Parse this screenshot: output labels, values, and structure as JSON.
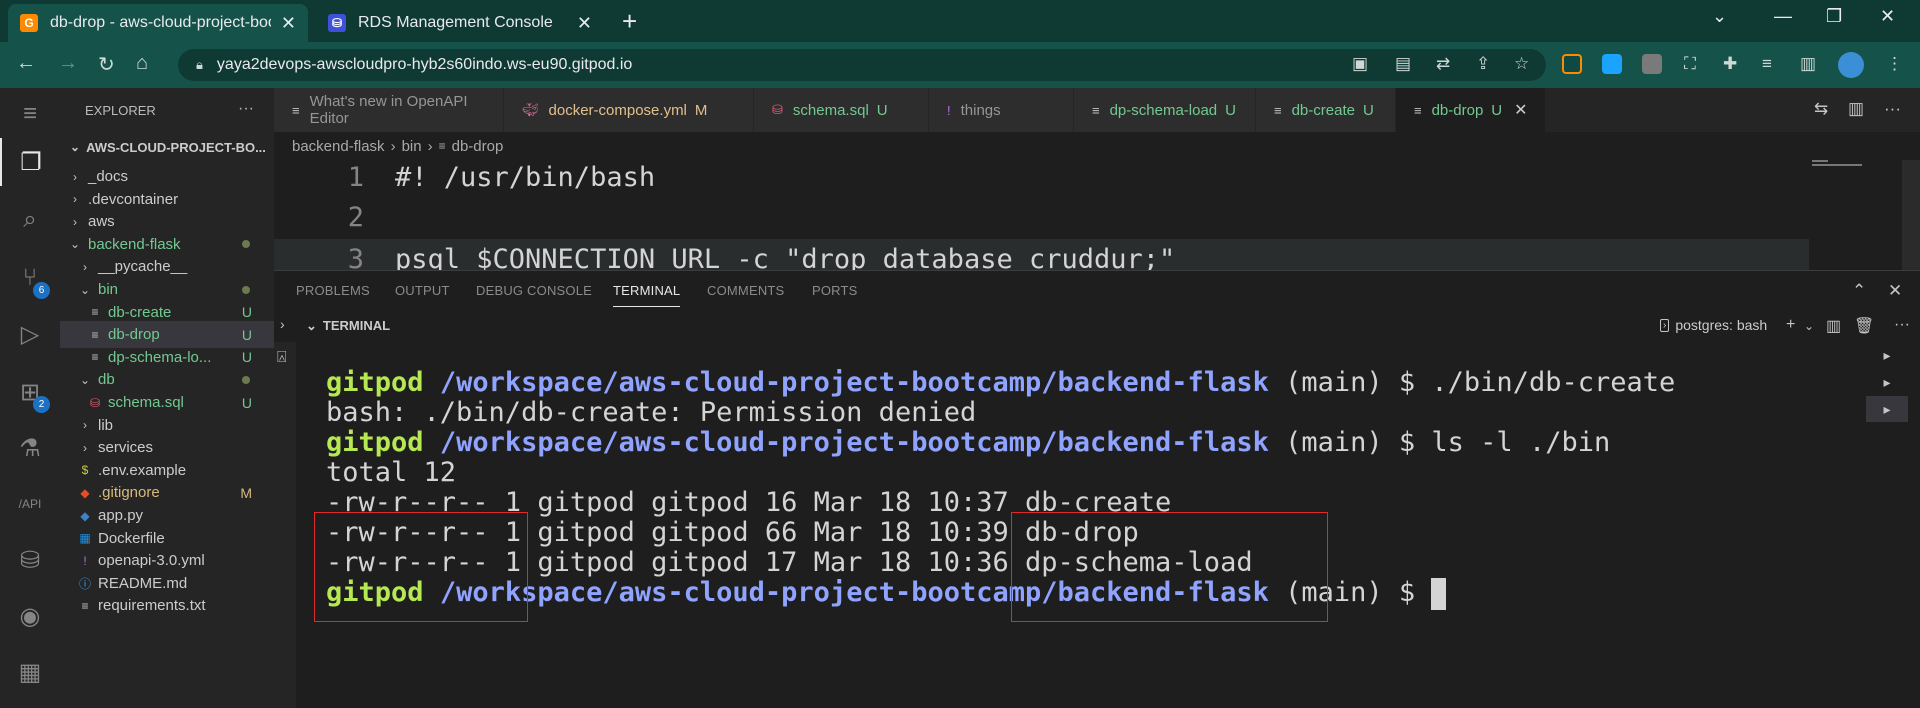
{
  "browser": {
    "tabs": [
      {
        "title": "db-drop - aws-cloud-project-boo",
        "icon": "gitpod-icon",
        "active": true
      },
      {
        "title": "RDS Management Console",
        "icon": "rds-icon",
        "active": false
      }
    ],
    "url": "yaya2devops-awscloudpro-hyb2s60indo.ws-eu90.gitpod.io"
  },
  "sidebar": {
    "header": "EXPLORER",
    "root": "AWS-CLOUD-PROJECT-BO...",
    "items": [
      {
        "label": "_docs",
        "kind": "folder",
        "depth": 1,
        "open": false
      },
      {
        "label": ".devcontainer",
        "kind": "folder",
        "depth": 1,
        "open": false
      },
      {
        "label": "aws",
        "kind": "folder",
        "depth": 1,
        "open": false
      },
      {
        "label": "backend-flask",
        "kind": "folder",
        "depth": 1,
        "open": true,
        "dot": true
      },
      {
        "label": "__pycache__",
        "kind": "folder",
        "depth": 2,
        "open": false
      },
      {
        "label": "bin",
        "kind": "folder",
        "depth": 2,
        "open": true,
        "dot": true
      },
      {
        "label": "db-create",
        "kind": "file",
        "depth": 3,
        "status": "U"
      },
      {
        "label": "db-drop",
        "kind": "file",
        "depth": 3,
        "status": "U",
        "selected": true
      },
      {
        "label": "dp-schema-lo...",
        "kind": "file",
        "depth": 3,
        "status": "U"
      },
      {
        "label": "db",
        "kind": "folder",
        "depth": 2,
        "open": true,
        "dot": true
      },
      {
        "label": "schema.sql",
        "kind": "sql",
        "depth": 3,
        "status": "U"
      },
      {
        "label": "lib",
        "kind": "folder",
        "depth": 2,
        "open": false
      },
      {
        "label": "services",
        "kind": "folder",
        "depth": 2,
        "open": false
      },
      {
        "label": ".env.example",
        "kind": "env",
        "depth": 2
      },
      {
        "label": ".gitignore",
        "kind": "git",
        "depth": 2,
        "status": "M"
      },
      {
        "label": "app.py",
        "kind": "py",
        "depth": 2
      },
      {
        "label": "Dockerfile",
        "kind": "docker",
        "depth": 2
      },
      {
        "label": "openapi-3.0.yml",
        "kind": "yml",
        "depth": 2
      },
      {
        "label": "README.md",
        "kind": "info",
        "depth": 2
      },
      {
        "label": "requirements.txt",
        "kind": "txt",
        "depth": 2
      }
    ]
  },
  "activity": {
    "scm_badge": "6",
    "ext_badge": "2"
  },
  "editor": {
    "tabs": [
      {
        "label": "What's new in OpenAPI Editor",
        "status": "",
        "icon": "list-icon"
      },
      {
        "label": "docker-compose.yml",
        "status": "M",
        "icon": "docker-icon"
      },
      {
        "label": "schema.sql",
        "status": "U",
        "icon": "database-icon"
      },
      {
        "label": "things",
        "status": "",
        "icon": "exclamation-icon"
      },
      {
        "label": "dp-schema-load",
        "status": "U",
        "icon": "list-icon"
      },
      {
        "label": "db-create",
        "status": "U",
        "icon": "list-icon"
      },
      {
        "label": "db-drop",
        "status": "U",
        "icon": "list-icon",
        "active": true
      }
    ],
    "breadcrumb": [
      "backend-flask",
      "bin",
      "db-drop"
    ],
    "lines": [
      {
        "n": "1",
        "text": "#! /usr/bin/bash"
      },
      {
        "n": "2",
        "text": ""
      },
      {
        "n": "3",
        "text": "psql $CONNECTION_URL -c \"drop database cruddur;\""
      }
    ]
  },
  "panel": {
    "tabs": [
      "PROBLEMS",
      "OUTPUT",
      "DEBUG CONSOLE",
      "TERMINAL",
      "COMMENTS",
      "PORTS"
    ],
    "active_tab": "TERMINAL",
    "section_label": "TERMINAL",
    "terminal_name": "postgres: bash"
  },
  "terminal": {
    "user": "gitpod",
    "path": "/workspace/aws-cloud-project-bootcamp/backend-flask",
    "branch": "(main) $",
    "cmd1": " ./bin/db-create",
    "out1": "bash: ./bin/db-create: Permission denied",
    "cmd2": " ls -l ./bin",
    "total": "total 12",
    "listing": [
      {
        "perm": "-rw-r--r-- 1",
        "meta": " gitpod gitpod 16 Mar 18 10:37 ",
        "name": "db-create"
      },
      {
        "perm": "-rw-r--r-- 1",
        "meta": " gitpod gitpod 66 Mar 18 10:39 ",
        "name": "db-drop"
      },
      {
        "perm": "-rw-r--r-- 1",
        "meta": " gitpod gitpod 17 Mar 18 10:36 ",
        "name": "dp-schema-load"
      }
    ]
  }
}
